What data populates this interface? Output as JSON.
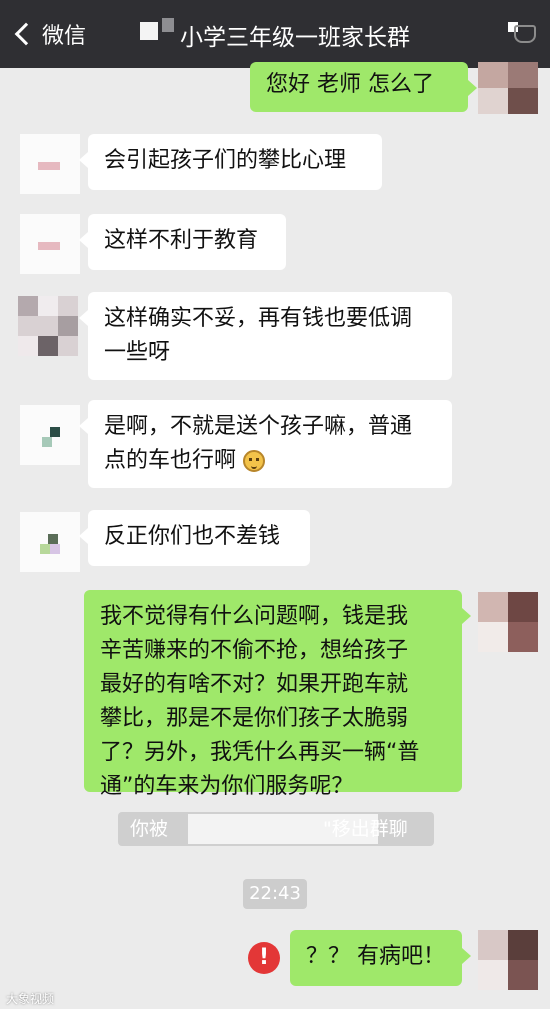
{
  "header": {
    "back_label": "微信",
    "title_fragment": "小学三年级一班家长群"
  },
  "messages": [
    {
      "side": "right",
      "text": "您好 老师 怎么了"
    },
    {
      "side": "left",
      "text": "会引起孩子们的攀比心理"
    },
    {
      "side": "left",
      "text": "这样不利于教育"
    },
    {
      "side": "left",
      "text_lines": [
        "这样确实不妥，再有钱也要低调",
        "一些呀"
      ]
    },
    {
      "side": "left",
      "text_lines": [
        "是啊，不就是送个孩子嘛，普通",
        "点的车也行啊"
      ],
      "emoji": "smile-emoji"
    },
    {
      "side": "left",
      "text": "反正你们也不差钱"
    },
    {
      "side": "right",
      "text_lines": [
        "我不觉得有什么问题啊，钱是我",
        "辛苦赚来的不偷不抢，想给孩子",
        "最好的有啥不对？如果开跑车就",
        "攀比，那是不是你们孩子太脆弱",
        "了？另外，我凭什么再买一辆“普",
        "通”的车来为你们服务呢？"
      ]
    },
    {
      "side": "right",
      "text": "？？ 有病吧！",
      "status": "failed"
    }
  ],
  "system_notice": {
    "prefix": "你被",
    "suffix": "\"移出群聊"
  },
  "timestamp": "22:43",
  "watermark": "大象视频",
  "icons": {
    "back": "chevron-left-icon",
    "group": "group-info-icon",
    "alert": "failed-send-icon"
  },
  "colors": {
    "topbar": "#2f2f33",
    "bubble_right": "#9fe86a",
    "bubble_left": "#ffffff",
    "background": "#ebebeb",
    "alert": "#e33737"
  }
}
